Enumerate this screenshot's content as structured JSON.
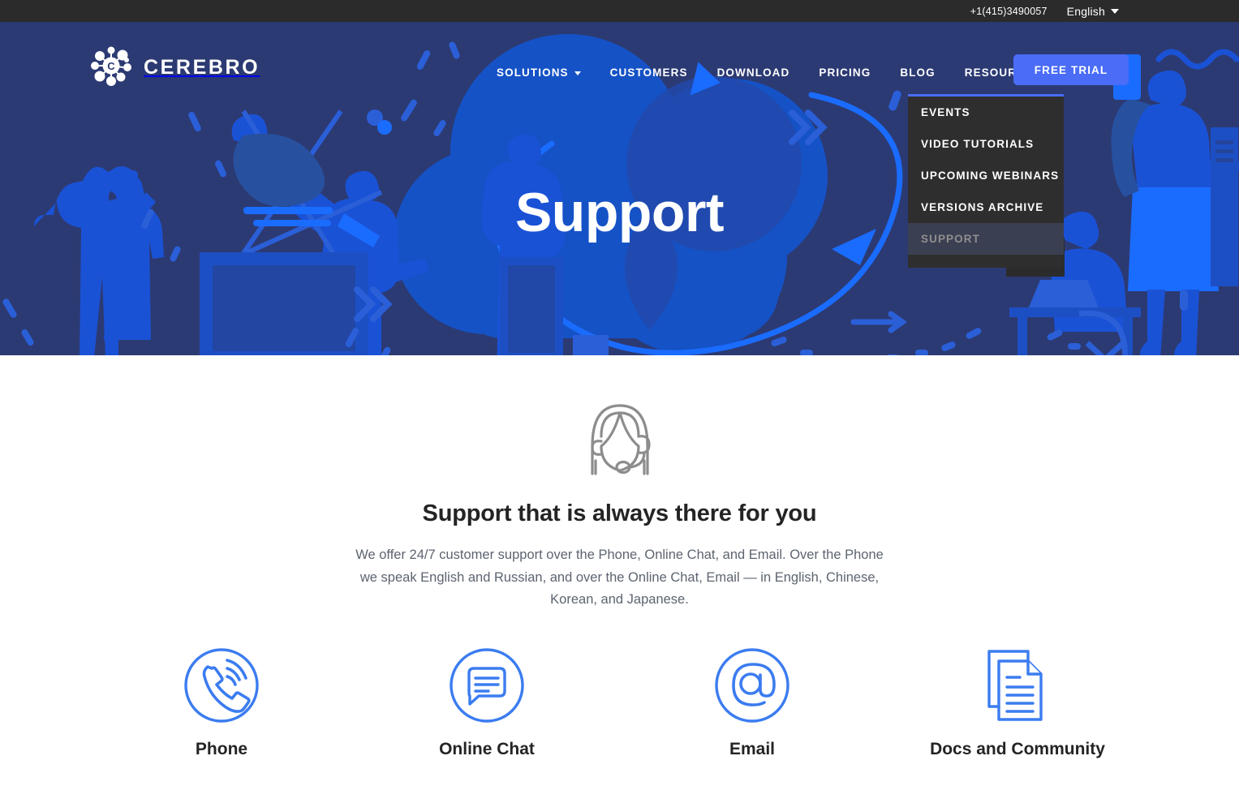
{
  "topbar": {
    "phone": "+1(415)3490057",
    "language": "English",
    "caret_icon": "chevron-down-icon"
  },
  "brand": {
    "name": "CEREBRO",
    "logo_icon": "molecule-network-icon"
  },
  "nav": {
    "items": [
      {
        "label": "SOLUTIONS",
        "has_caret": true
      },
      {
        "label": "CUSTOMERS",
        "has_caret": false
      },
      {
        "label": "DOWNLOAD",
        "has_caret": false
      },
      {
        "label": "PRICING",
        "has_caret": false
      },
      {
        "label": "BLOG",
        "has_caret": false
      },
      {
        "label": "RESOURCES",
        "has_caret": true
      }
    ],
    "cta_label": "FREE TRIAL",
    "cta_color": "#4a6cf7"
  },
  "dropdown": {
    "open_for": "RESOURCES",
    "items": [
      {
        "label": "EVENTS",
        "active": false
      },
      {
        "label": "VIDEO TUTORIALS",
        "active": false
      },
      {
        "label": "UPCOMING WEBINARS",
        "active": false
      },
      {
        "label": "VERSIONS ARCHIVE",
        "active": false
      },
      {
        "label": "SUPPORT",
        "active": true
      }
    ],
    "background": "#2e2e2e",
    "active_background": "#3b3f52",
    "accent_border": "#4a6cf7"
  },
  "hero": {
    "title": "Support",
    "background": "#2c3a73",
    "cloud_color": "#1552c6",
    "accent_color": "#1a5cf0"
  },
  "main": {
    "agent_icon": "support-agent-headset-icon",
    "heading": "Support that is always there for you",
    "paragraph": "We offer 24/7 customer support over the Phone, Online Chat, and Email. Over the Phone we speak English and Russian, and over the Online Chat, Email — in English, Chinese, Korean, and Japanese.",
    "features": [
      {
        "label": "Phone",
        "icon": "phone-ringing-circle-icon"
      },
      {
        "label": "Online Chat",
        "icon": "chat-bubble-circle-icon"
      },
      {
        "label": "Email",
        "icon": "at-sign-circle-icon"
      },
      {
        "label": "Docs and Community",
        "icon": "documents-stack-icon"
      }
    ],
    "icon_color": "#3b7cf0"
  }
}
